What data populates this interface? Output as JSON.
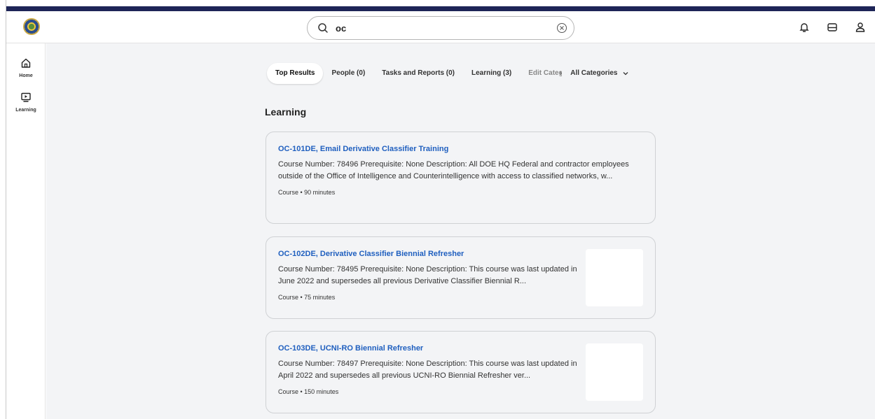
{
  "search": {
    "value": "oc"
  },
  "sidebar": {
    "items": [
      {
        "label": "Home"
      },
      {
        "label": "Learning"
      }
    ]
  },
  "tabs": [
    {
      "label": "Top Results",
      "active": true
    },
    {
      "label": "People (0)"
    },
    {
      "label": "Tasks and Reports (0)"
    },
    {
      "label": "Learning (3)"
    },
    {
      "label": "Edit Catego"
    },
    {
      "label": "All Categories"
    }
  ],
  "section_title": "Learning",
  "results": [
    {
      "title": "OC-101DE, Email Derivative Classifier Training",
      "description": "Course Number: 78496 Prerequisite: None  Description: All DOE HQ Federal and contractor employees outside of the Office of Intelligence and Counterintelligence with access to classified networks, w...",
      "meta": "Course  •  90 minutes"
    },
    {
      "title": "OC-102DE, Derivative Classifier Biennial Refresher",
      "description": "Course Number: 78495 Prerequisite: None  Description: This course was last updated in June 2022 and supersedes all previous Derivative Classifier Biennial R...",
      "meta": "Course  •  75 minutes"
    },
    {
      "title": "OC-103DE, UCNI-RO Biennial Refresher",
      "description": "Course Number: 78497 Prerequisite: None  Description: This course was last updated in April 2022 and supersedes all previous UCNI-RO Biennial Refresher ver...",
      "meta": "Course  •  150 minutes"
    }
  ],
  "colors": {
    "brand_bar": "#1e2557",
    "link": "#1f5fbf"
  }
}
